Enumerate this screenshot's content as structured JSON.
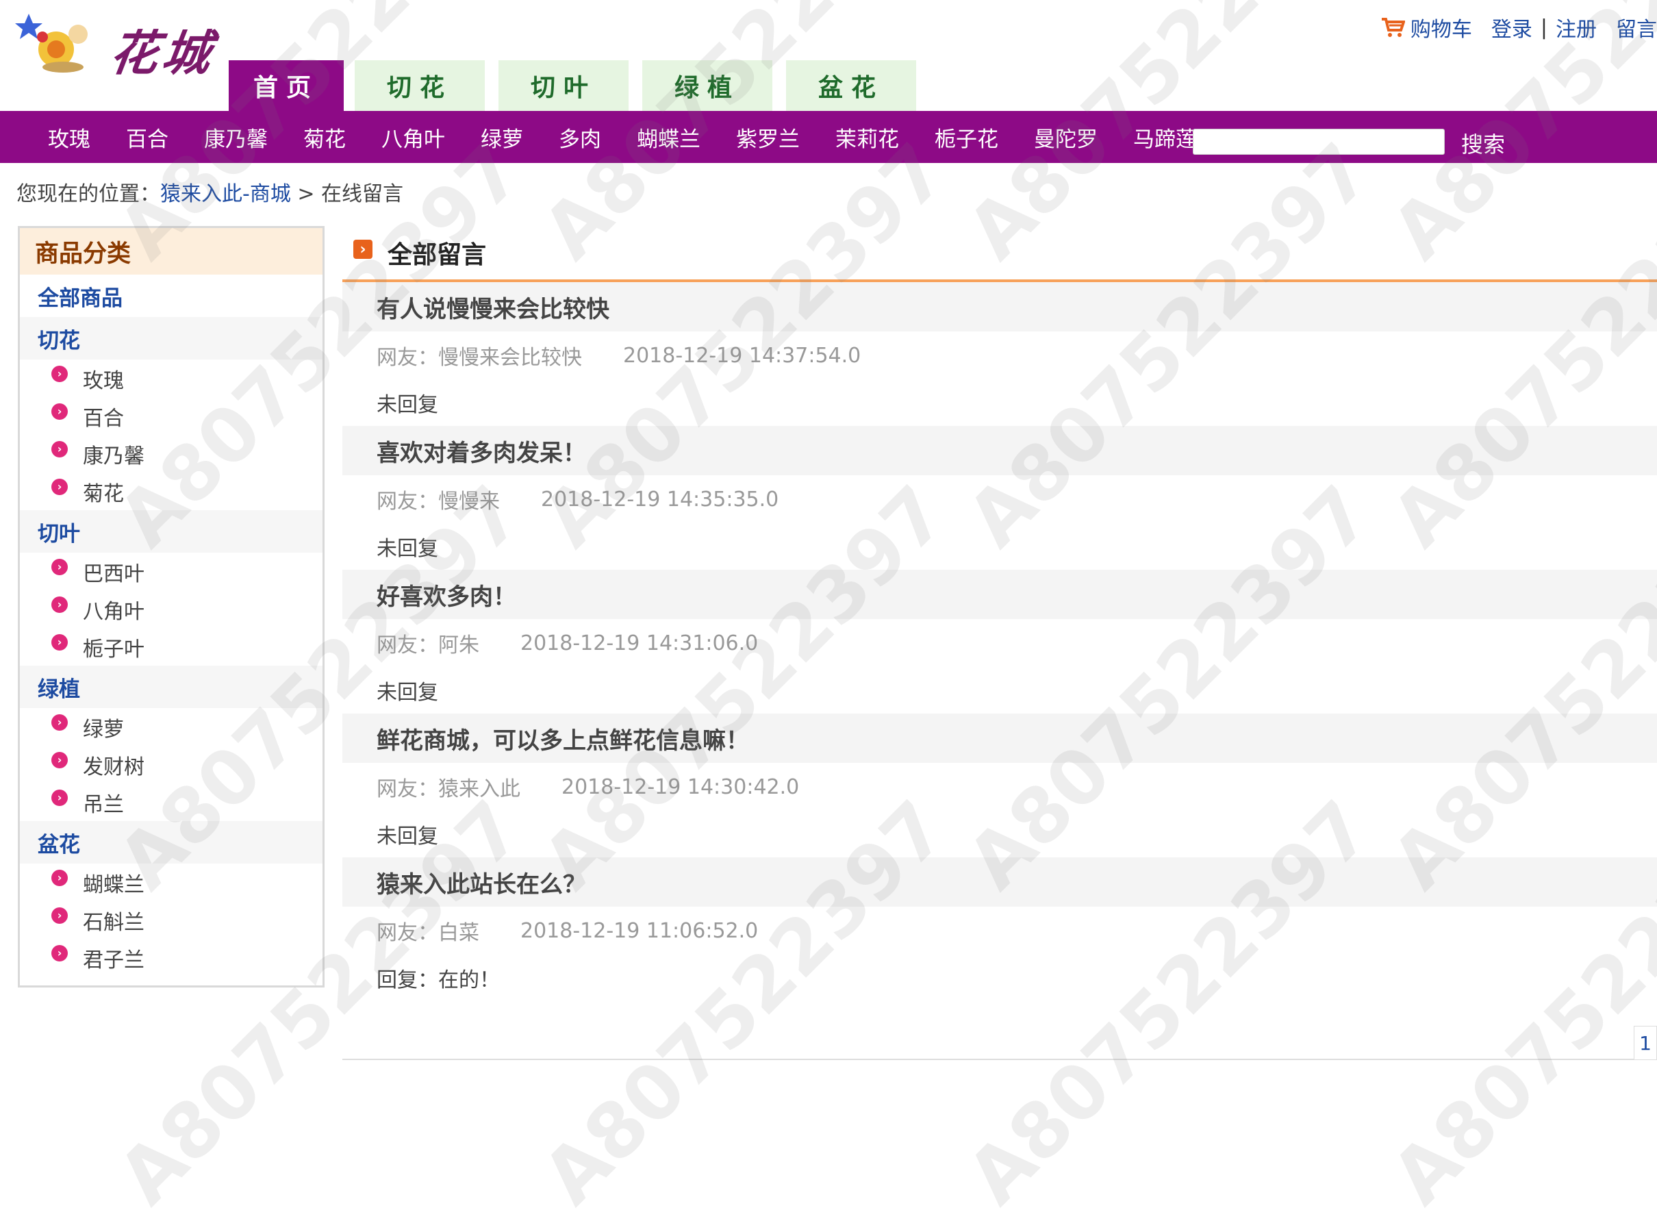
{
  "logo": {
    "text": "花城"
  },
  "tabs": [
    "首页",
    "切花",
    "切叶",
    "绿植",
    "盆花"
  ],
  "toplinks": {
    "cart": "购物车",
    "login": "登录",
    "sep": "|",
    "register": "注册",
    "message": "留言"
  },
  "nav": [
    "玫瑰",
    "百合",
    "康乃馨",
    "菊花",
    "八角叶",
    "绿萝",
    "多肉",
    "蝴蝶兰",
    "紫罗兰",
    "茉莉花",
    "栀子花",
    "曼陀罗",
    "马蹄莲"
  ],
  "search": {
    "button": "搜索",
    "value": ""
  },
  "breadcrumb": {
    "prefix": "您现在的位置：",
    "link": "猿来入此-商城",
    "sep": " > ",
    "current": "在线留言"
  },
  "sidebar": {
    "title": "商品分类",
    "all": "全部商品",
    "groups": [
      {
        "name": "切花",
        "items": [
          "玫瑰",
          "百合",
          "康乃馨",
          "菊花"
        ]
      },
      {
        "name": "切叶",
        "items": [
          "巴西叶",
          "八角叶",
          "栀子叶"
        ]
      },
      {
        "name": "绿植",
        "items": [
          "绿萝",
          "发财树",
          "吊兰"
        ]
      },
      {
        "name": "盆花",
        "items": [
          "蝴蝶兰",
          "石斛兰",
          "君子兰"
        ]
      }
    ]
  },
  "main": {
    "title": "全部留言",
    "messages": [
      {
        "title": "有人说慢慢来会比较快",
        "author": "网友：慢慢来会比较快",
        "time": "2018-12-19 14:37:54.0",
        "reply": "未回复"
      },
      {
        "title": "喜欢对着多肉发呆！",
        "author": "网友：慢慢来",
        "time": "2018-12-19 14:35:35.0",
        "reply": "未回复"
      },
      {
        "title": "好喜欢多肉！",
        "author": "网友：阿朱",
        "time": "2018-12-19 14:31:06.0",
        "reply": "未回复"
      },
      {
        "title": "鲜花商城，可以多上点鲜花信息嘛！",
        "author": "网友：猿来入此",
        "time": "2018-12-19 14:30:42.0",
        "reply": "未回复"
      },
      {
        "title": "猿来入此站长在么？",
        "author": "网友：白菜",
        "time": "2018-12-19 11:06:52.0",
        "reply": "回复：在的！"
      }
    ]
  },
  "pager": {
    "current": "1"
  },
  "watermark": "A807522397",
  "colors": {
    "nav_purple": "#8d0a86",
    "tab_green_bg": "#e6f5e1",
    "accent_orange": "#f7a15a",
    "link_blue": "#1d4ba1"
  }
}
